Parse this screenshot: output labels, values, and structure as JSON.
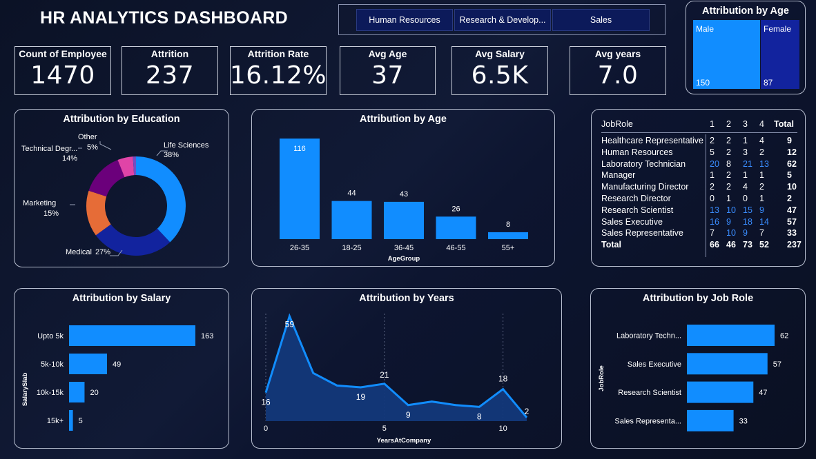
{
  "header": {
    "title": "HR ANALYTICS DASHBOARD"
  },
  "slicer": {
    "options": [
      "Human Resources",
      "Research & Develop...",
      "Sales"
    ]
  },
  "kpis": [
    {
      "label": "Count of Employee",
      "value": "1470"
    },
    {
      "label": "Attrition",
      "value": "237"
    },
    {
      "label": "Attrition Rate",
      "value": "16.12%"
    },
    {
      "label": "Avg Age",
      "value": "37"
    },
    {
      "label": "Avg Salary",
      "value": "6.5K"
    },
    {
      "label": "Avg years",
      "value": "7.0"
    }
  ],
  "gender_card": {
    "title": "Attribution by Age",
    "male_label": "Male",
    "male_value": "150",
    "female_label": "Female",
    "female_value": "87",
    "colors": {
      "male": "#118dff",
      "female": "#12239e"
    }
  },
  "education_card": {
    "title": "Attribution by Education",
    "slices": [
      {
        "name": "Life Sciences",
        "pct": "38%",
        "value": 38,
        "color": "#118dff"
      },
      {
        "name": "Medical",
        "pct": "27%",
        "value": 27,
        "color": "#12239e"
      },
      {
        "name": "Marketing",
        "pct": "15%",
        "value": 15,
        "color": "#e66c37"
      },
      {
        "name": "Technical Degr...",
        "pct": "14%",
        "value": 14,
        "color": "#6b007b"
      },
      {
        "name": "Other",
        "pct": "5%",
        "value": 5,
        "color": "#e044a7"
      },
      {
        "name": "",
        "pct": "",
        "value": 1,
        "color": "#744ec2"
      }
    ]
  },
  "age_card": {
    "title": "Attribution by Age",
    "xlabel": "AgeGroup"
  },
  "jobrole_table": {
    "headers": [
      "JobRole",
      "1",
      "2",
      "3",
      "4",
      "Total"
    ],
    "rows": [
      {
        "role": "Healthcare Representative",
        "v": [
          "2",
          "2",
          "1",
          "4"
        ],
        "total": "9"
      },
      {
        "role": "Human Resources",
        "v": [
          "5",
          "2",
          "3",
          "2"
        ],
        "total": "12"
      },
      {
        "role": "Laboratory Technician",
        "v": [
          "20",
          "8",
          "21",
          "13"
        ],
        "total": "62"
      },
      {
        "role": "Manager",
        "v": [
          "1",
          "2",
          "1",
          "1"
        ],
        "total": "5"
      },
      {
        "role": "Manufacturing Director",
        "v": [
          "2",
          "2",
          "4",
          "2"
        ],
        "total": "10"
      },
      {
        "role": "Research Director",
        "v": [
          "0",
          "1",
          "0",
          "1"
        ],
        "total": "2"
      },
      {
        "role": "Research Scientist",
        "v": [
          "13",
          "10",
          "15",
          "9"
        ],
        "total": "47"
      },
      {
        "role": "Sales Executive",
        "v": [
          "16",
          "9",
          "18",
          "14"
        ],
        "total": "57"
      },
      {
        "role": "Sales Representative",
        "v": [
          "7",
          "10",
          "9",
          "7"
        ],
        "total": "33"
      }
    ],
    "total_row": {
      "role": "Total",
      "v": [
        "66",
        "46",
        "73",
        "52"
      ],
      "total": "237"
    }
  },
  "salary_card": {
    "title": "Attribution by Salary",
    "ylabel": "SalarySlab"
  },
  "years_card": {
    "title": "Attribution by Years",
    "xlabel": "YearsAtCompany"
  },
  "jobrole_card": {
    "title": "Attribution by Job Role",
    "ylabel": "JobRole"
  },
  "chart_data": [
    {
      "type": "pie",
      "title": "Attribution by Education",
      "categories": [
        "Life Sciences",
        "Medical",
        "Marketing",
        "Technical Degr...",
        "Other",
        ""
      ],
      "values": [
        38,
        27,
        15,
        14,
        5,
        1
      ]
    },
    {
      "type": "bar",
      "title": "Attribution by Age",
      "categories": [
        "26-35",
        "18-25",
        "36-45",
        "46-55",
        "55+"
      ],
      "values": [
        116,
        44,
        43,
        26,
        8
      ],
      "xlabel": "AgeGroup",
      "ylabel": "",
      "color": "#118dff"
    },
    {
      "type": "bar",
      "orientation": "horizontal",
      "title": "Attribution by Salary",
      "categories": [
        "Upto 5k",
        "5k-10k",
        "10k-15k",
        "15k+"
      ],
      "values": [
        163,
        49,
        20,
        5
      ],
      "xlabel": "",
      "ylabel": "SalarySlab",
      "color": "#118dff"
    },
    {
      "type": "area",
      "title": "Attribution by Years",
      "x": [
        0,
        1,
        2,
        3,
        4,
        5,
        6,
        7,
        8,
        9,
        10,
        11
      ],
      "values": [
        16,
        59,
        27,
        20,
        19,
        21,
        9,
        11,
        9,
        8,
        18,
        2
      ],
      "labeled_points": [
        0,
        1,
        4,
        5,
        6,
        9,
        10,
        11
      ],
      "x_ticks": [
        "0",
        "5",
        "10"
      ],
      "xlim": [
        0,
        11
      ],
      "ylim": [
        0,
        62
      ],
      "xlabel": "YearsAtCompany",
      "ylabel": "",
      "color": "#118dff"
    },
    {
      "type": "bar",
      "orientation": "horizontal",
      "title": "Attribution by Job Role",
      "categories": [
        "Laboratory Techn...",
        "Sales Executive",
        "Research Scientist",
        "Sales Representa..."
      ],
      "values": [
        62,
        57,
        47,
        33
      ],
      "xlabel": "",
      "ylabel": "JobRole",
      "color": "#118dff"
    }
  ]
}
